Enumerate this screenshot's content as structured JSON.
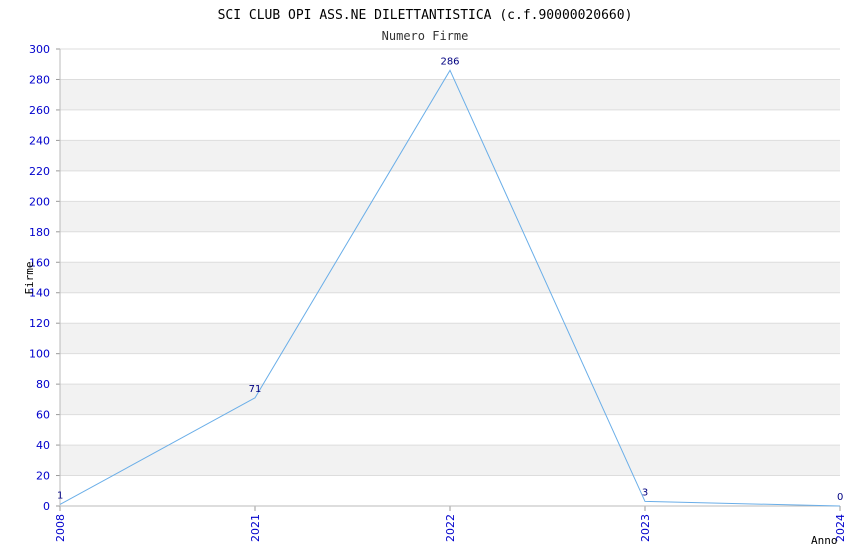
{
  "chart_data": {
    "type": "line",
    "title": "SCI CLUB OPI ASS.NE DILETTANTISTICA (c.f.90000020660)",
    "subtitle": "Numero Firme",
    "xlabel": "Anno",
    "ylabel": "Firme",
    "categories": [
      "2008",
      "2021",
      "2022",
      "2023",
      "2024"
    ],
    "series": [
      {
        "values": [
          1,
          71,
          286,
          3,
          0
        ]
      }
    ],
    "data_labels": [
      "1",
      "71",
      "286",
      "3",
      "0"
    ],
    "ylim": [
      0,
      300
    ],
    "yticks": [
      "0",
      "20",
      "40",
      "60",
      "80",
      "100",
      "120",
      "140",
      "160",
      "180",
      "200",
      "220",
      "240",
      "260",
      "280",
      "300"
    ],
    "grid": true,
    "colors": {
      "line": "#6aaee8",
      "band": "#f2f2f2",
      "grid": "#dddddd",
      "tick_text": "#0000cc",
      "data_label": "#000080"
    }
  }
}
